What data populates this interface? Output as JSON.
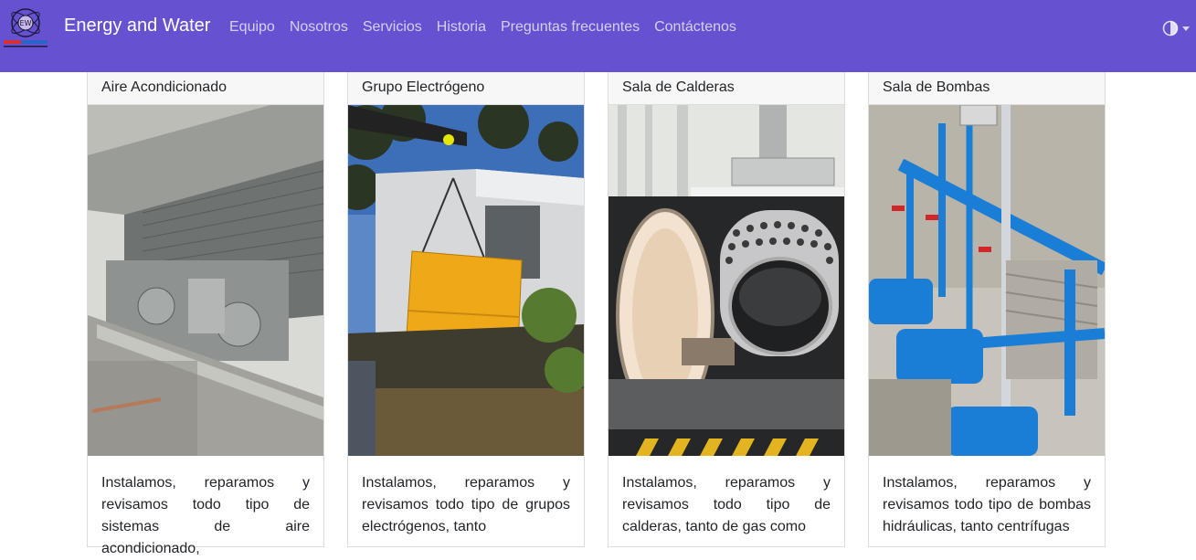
{
  "navbar": {
    "brand": "Energy and Water",
    "links": [
      {
        "label": "Equipo"
      },
      {
        "label": "Nosotros"
      },
      {
        "label": "Servicios"
      },
      {
        "label": "Historia"
      },
      {
        "label": "Preguntas frecuentes"
      },
      {
        "label": "Contáctenos"
      }
    ],
    "theme_icon": "half-circle-contrast-icon",
    "accent": "#6652d0"
  },
  "cards": [
    {
      "title": "Aire Acondicionado",
      "text": "Instalamos, reparamos y revisamos todo tipo de sistemas de aire acondicionado,",
      "image": "air-conditioning-unit-photo"
    },
    {
      "title": "Grupo Electrógeno",
      "text": "Instalamos, reparamos y revisamos todo tipo de grupos electrógenos, tanto",
      "image": "generator-photo"
    },
    {
      "title": "Sala de Calderas",
      "text": "Instalamos, reparamos y revisamos todo tipo de calderas, tanto de gas como",
      "image": "boiler-photo"
    },
    {
      "title": "Sala de Bombas",
      "text": "Instalamos, reparamos y revisamos todo tipo de bombas hidráulicas, tanto centrífugas",
      "image": "pump-room-photo"
    }
  ]
}
